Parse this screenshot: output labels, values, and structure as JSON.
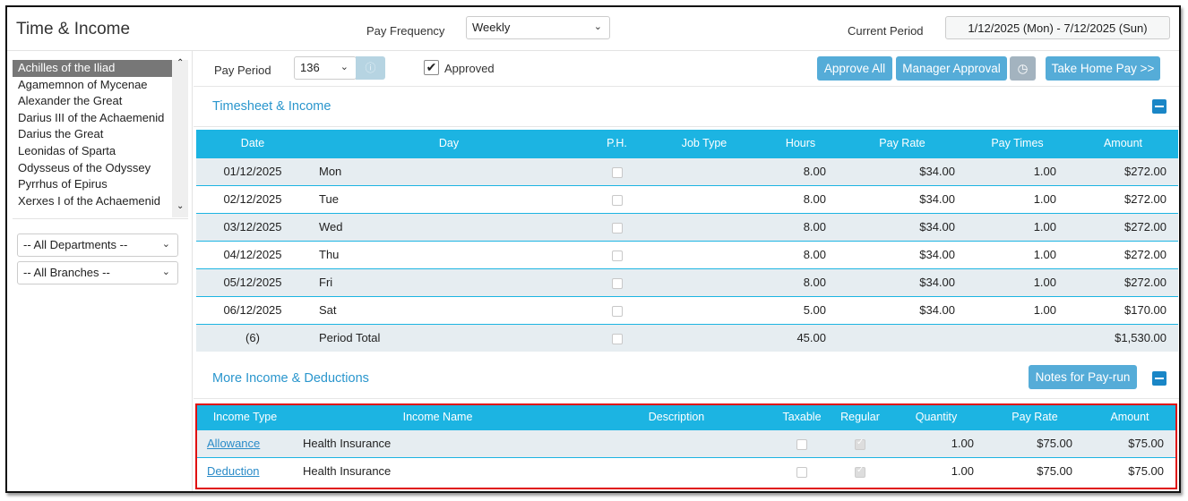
{
  "header": {
    "title": "Time & Income",
    "pay_frequency_label": "Pay Frequency",
    "pay_frequency_value": "Weekly",
    "current_period_label": "Current Period",
    "current_period_value": "1/12/2025 (Mon) - 7/12/2025 (Sun)"
  },
  "sidebar": {
    "employees": [
      "Achilles of the Iliad",
      "Agamemnon of Mycenae",
      "Alexander the Great",
      "Darius III of the Achaemenid",
      "Darius the Great",
      "Leonidas of Sparta",
      "Odysseus of the Odyssey",
      "Pyrrhus of Epirus",
      "Xerxes I of the Achaemenid"
    ],
    "selected_index": 0,
    "department": "-- All Departments --",
    "branch": "-- All Branches --"
  },
  "toolbar": {
    "pay_period_label": "Pay Period",
    "pay_period_value": "136",
    "approved_label": "Approved",
    "approved_checked": true,
    "approve_all": "Approve All",
    "manager_approval": "Manager Approval",
    "take_home_pay": "Take Home Pay >>"
  },
  "timesheet": {
    "title": "Timesheet & Income",
    "columns": [
      "Date",
      "Day",
      "P.H.",
      "Job Type",
      "Hours",
      "Pay Rate",
      "Pay Times",
      "Amount"
    ],
    "rows": [
      [
        "01/12/2025",
        "Mon",
        "",
        "",
        "8.00",
        "$34.00",
        "1.00",
        "$272.00"
      ],
      [
        "02/12/2025",
        "Tue",
        "",
        "",
        "8.00",
        "$34.00",
        "1.00",
        "$272.00"
      ],
      [
        "03/12/2025",
        "Wed",
        "",
        "",
        "8.00",
        "$34.00",
        "1.00",
        "$272.00"
      ],
      [
        "04/12/2025",
        "Thu",
        "",
        "",
        "8.00",
        "$34.00",
        "1.00",
        "$272.00"
      ],
      [
        "05/12/2025",
        "Fri",
        "",
        "",
        "8.00",
        "$34.00",
        "1.00",
        "$272.00"
      ],
      [
        "06/12/2025",
        "Sat",
        "",
        "",
        "5.00",
        "$34.00",
        "1.00",
        "$170.00"
      ],
      [
        "(6)",
        "Period Total",
        "",
        "",
        "45.00",
        "",
        "",
        "$1,530.00"
      ]
    ]
  },
  "income": {
    "title": "More Income & Deductions",
    "notes_button": "Notes for Pay-run",
    "columns": [
      "Income Type",
      "Income Name",
      "Description",
      "Taxable",
      "Regular",
      "Quantity",
      "Pay Rate",
      "Amount"
    ],
    "rows": [
      [
        "Allowance",
        "Health Insurance",
        "",
        "",
        "",
        "1.00",
        "$75.00",
        "$75.00"
      ],
      [
        "Deduction",
        "Health Insurance",
        "",
        "",
        "",
        "1.00",
        "$75.00",
        "$75.00"
      ]
    ]
  }
}
